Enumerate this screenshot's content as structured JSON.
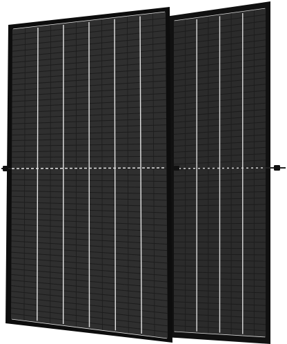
{
  "image": {
    "subject": "two-black-bifacial-solar-panels",
    "background_color": "#ffffff",
    "panels": [
      {
        "role": "back",
        "frame_color": "#111111",
        "cell_color": "#2b2b2b",
        "busbar_color": "#dcdcdc",
        "columns": 4,
        "rows_per_half": 26
      },
      {
        "role": "front",
        "frame_color": "#0d0d0d",
        "cell_color": "#2f2f2f",
        "busbar_color": "#e6e6e6",
        "columns": 6,
        "rows_per_half": 26
      }
    ],
    "junction": {
      "cable_color": "#222222",
      "connector_color": "#111111"
    }
  }
}
